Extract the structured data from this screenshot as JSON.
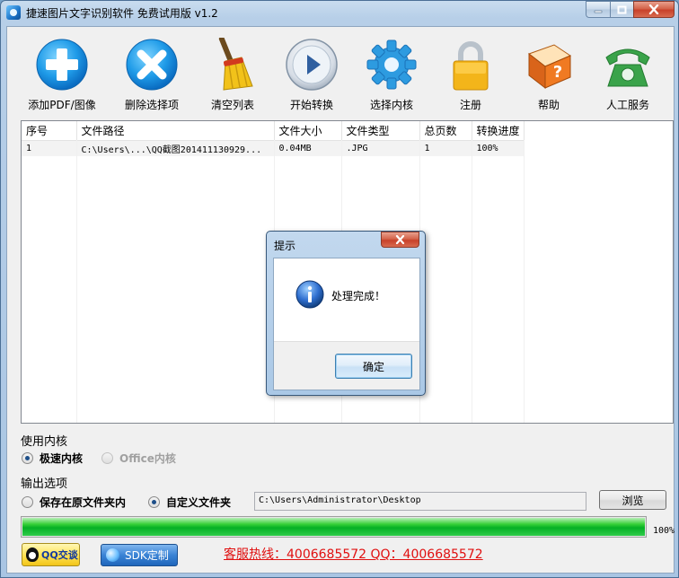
{
  "window": {
    "title": "捷速图片文字识别软件 免费试用版 v1.2"
  },
  "toolbar": [
    {
      "label": "添加PDF/图像",
      "icon": "add-icon"
    },
    {
      "label": "删除选择项",
      "icon": "delete-icon"
    },
    {
      "label": "清空列表",
      "icon": "broom-icon"
    },
    {
      "label": "开始转换",
      "icon": "play-icon"
    },
    {
      "label": "选择内核",
      "icon": "gear-icon"
    },
    {
      "label": "注册",
      "icon": "lock-icon"
    },
    {
      "label": "帮助",
      "icon": "help-book-icon"
    },
    {
      "label": "人工服务",
      "icon": "phone-icon"
    }
  ],
  "table": {
    "headers": [
      "序号",
      "文件路径",
      "文件大小",
      "文件类型",
      "总页数",
      "转换进度"
    ],
    "rows": [
      [
        "1",
        "C:\\Users\\...\\QQ截图201411130929...",
        "0.04MB",
        ".JPG",
        "1",
        "100%"
      ]
    ]
  },
  "dialog": {
    "title": "提示",
    "message": "处理完成！",
    "ok_label": "确定"
  },
  "engine": {
    "section_label": "使用内核",
    "fast_label": "极速内核",
    "office_label": "Office内核"
  },
  "output": {
    "section_label": "输出选项",
    "original_label": "保存在原文件夹内",
    "custom_label": "自定义文件夹",
    "path": "C:\\Users\\Administrator\\Desktop",
    "browse_label": "浏览"
  },
  "progress": {
    "value": 1.0,
    "label": "100%"
  },
  "footer": {
    "qq_label": "QQ交谈",
    "sdk_label": "SDK定制",
    "hotline": "客服热线：4006685572 QQ：4006685572"
  }
}
